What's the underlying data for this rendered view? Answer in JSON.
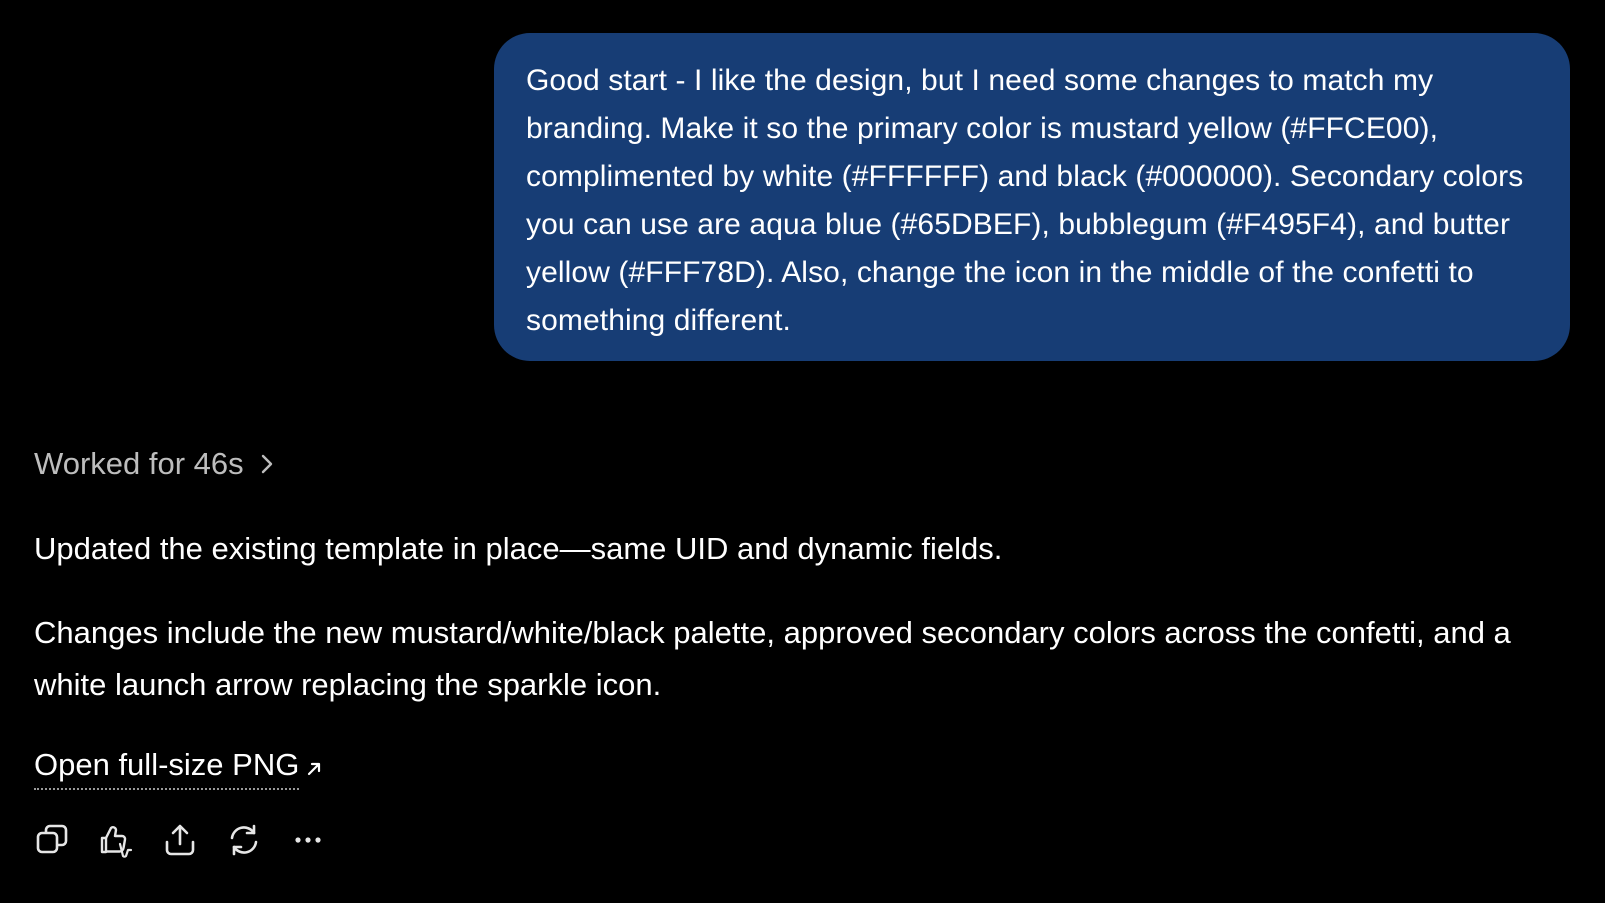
{
  "user_message": {
    "text": "Good start - I like the design, but I need some changes to match my branding. Make it so the primary color is mustard yellow (#FFCE00), complimented by white (#FFFFFF) and black (#000000). Secondary colors you can use are aqua blue (#65DBEF), bubblegum (#F495F4), and butter yellow (#FFF78D). Also, change the icon in the middle of the confetti to something different."
  },
  "assistant": {
    "worked_label": "Worked for 46s",
    "paragraph_1": "Updated the existing template in place—same UID and dynamic fields.",
    "paragraph_2": "Changes include the new mustard/white/black palette, approved secondary colors across the confetti, and a white launch arrow replacing the sparkle icon.",
    "link_label": "Open full-size PNG"
  },
  "actions": [
    {
      "icon": "copy-icon"
    },
    {
      "icon": "thumbs-feedback-icon"
    },
    {
      "icon": "share-icon"
    },
    {
      "icon": "regenerate-icon"
    },
    {
      "icon": "more-icon"
    }
  ],
  "colors": {
    "background": "#000000",
    "user_bubble": "#173d75",
    "text": "#ffffff",
    "muted_text": "#bdbdbd"
  }
}
